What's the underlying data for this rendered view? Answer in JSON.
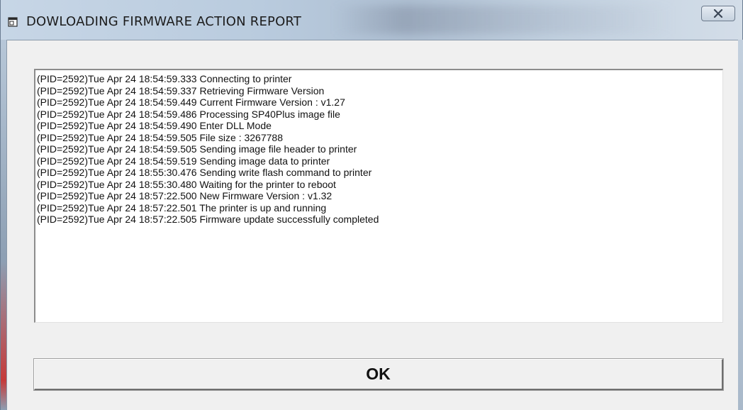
{
  "window": {
    "title": "DOWLOADING FIRMWARE ACTION REPORT",
    "close_label": "X"
  },
  "log": {
    "lines": [
      "(PID=2592)Tue Apr 24 18:54:59.333 Connecting to printer",
      "(PID=2592)Tue Apr 24 18:54:59.337 Retrieving Firmware Version",
      "(PID=2592)Tue Apr 24 18:54:59.449 Current Firmware Version : v1.27",
      "(PID=2592)Tue Apr 24 18:54:59.486 Processing SP40Plus image file",
      "(PID=2592)Tue Apr 24 18:54:59.490 Enter DLL Mode",
      "(PID=2592)Tue Apr 24 18:54:59.505 File size : 3267788",
      "(PID=2592)Tue Apr 24 18:54:59.505 Sending image file header to printer",
      "(PID=2592)Tue Apr 24 18:54:59.519 Sending image data to printer",
      "(PID=2592)Tue Apr 24 18:55:30.476 Sending write flash command to printer",
      "(PID=2592)Tue Apr 24 18:55:30.480 Waiting for the printer to reboot",
      "(PID=2592)Tue Apr 24 18:57:22.500 New Firmware Version : v1.32",
      "(PID=2592)Tue Apr 24 18:57:22.501 The printer is up and running",
      "(PID=2592)Tue Apr 24 18:57:22.505 Firmware update successfully completed"
    ]
  },
  "buttons": {
    "ok_label": "OK"
  },
  "icons": {
    "title": "window-app-icon",
    "close": "close-icon"
  },
  "colors": {
    "client_bg": "#f0f0f0",
    "log_bg": "#ffffff"
  }
}
